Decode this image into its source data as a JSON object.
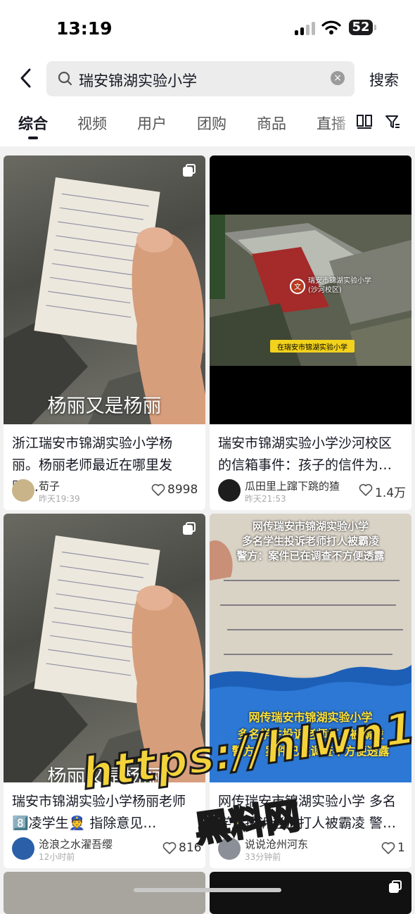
{
  "status_bar": {
    "time": "13:19",
    "battery": "52"
  },
  "search": {
    "query": "瑞安锦湖实验小学",
    "submit_label": "搜索"
  },
  "tabs": [
    "综合",
    "视频",
    "用户",
    "团购",
    "商品",
    "直播"
  ],
  "cards": [
    {
      "caption": "杨丽又是杨丽",
      "title": "浙江瑞安市锦湖实验小学杨丽。杨丽老师最近在哪里发财…",
      "author": "荀子",
      "time": "昨天19:39",
      "likes": "8998"
    },
    {
      "map_labels": {
        "school": "瑞安市锦湖实验小学(沙河校区)",
        "banner": "在瑞安市锦湖实验小学"
      },
      "title": "瑞安市锦湖实验小学沙河校区的信箱事件：孩子的信件为…",
      "author": "瓜田里上蹿下跳的猹",
      "time": "昨天21:53",
      "likes": "1.4万"
    },
    {
      "caption": "杨丽又是杨丽",
      "title": "瑞安市锦湖实验小学杨丽老师8️⃣凌学生👮 指除意见…",
      "author": "沧浪之水濯吾缨",
      "time": "12小时前",
      "likes": "816"
    },
    {
      "overlay_top": [
        "网传瑞安市锦湖实验小学",
        "多名学生投诉老师打人被霸凌",
        "警方：案件已在调查不方便透露"
      ],
      "overlay_bottom": [
        "网传瑞安市锦湖实验小学",
        "多名学生投诉老师打人被霸凌",
        "警方：案件已在调查不方便透露"
      ],
      "title": "网传瑞安市锦湖实验小学 多名学生投诉老师打人被霸凌 警…",
      "author": "说说沧州河东",
      "time": "33分钟前",
      "likes": "1"
    }
  ],
  "watermark": {
    "url": "https://hlwn1.com",
    "name": "黑料网"
  },
  "colors": {
    "accent_text": "#161823",
    "watermark": "#f4d33a"
  }
}
